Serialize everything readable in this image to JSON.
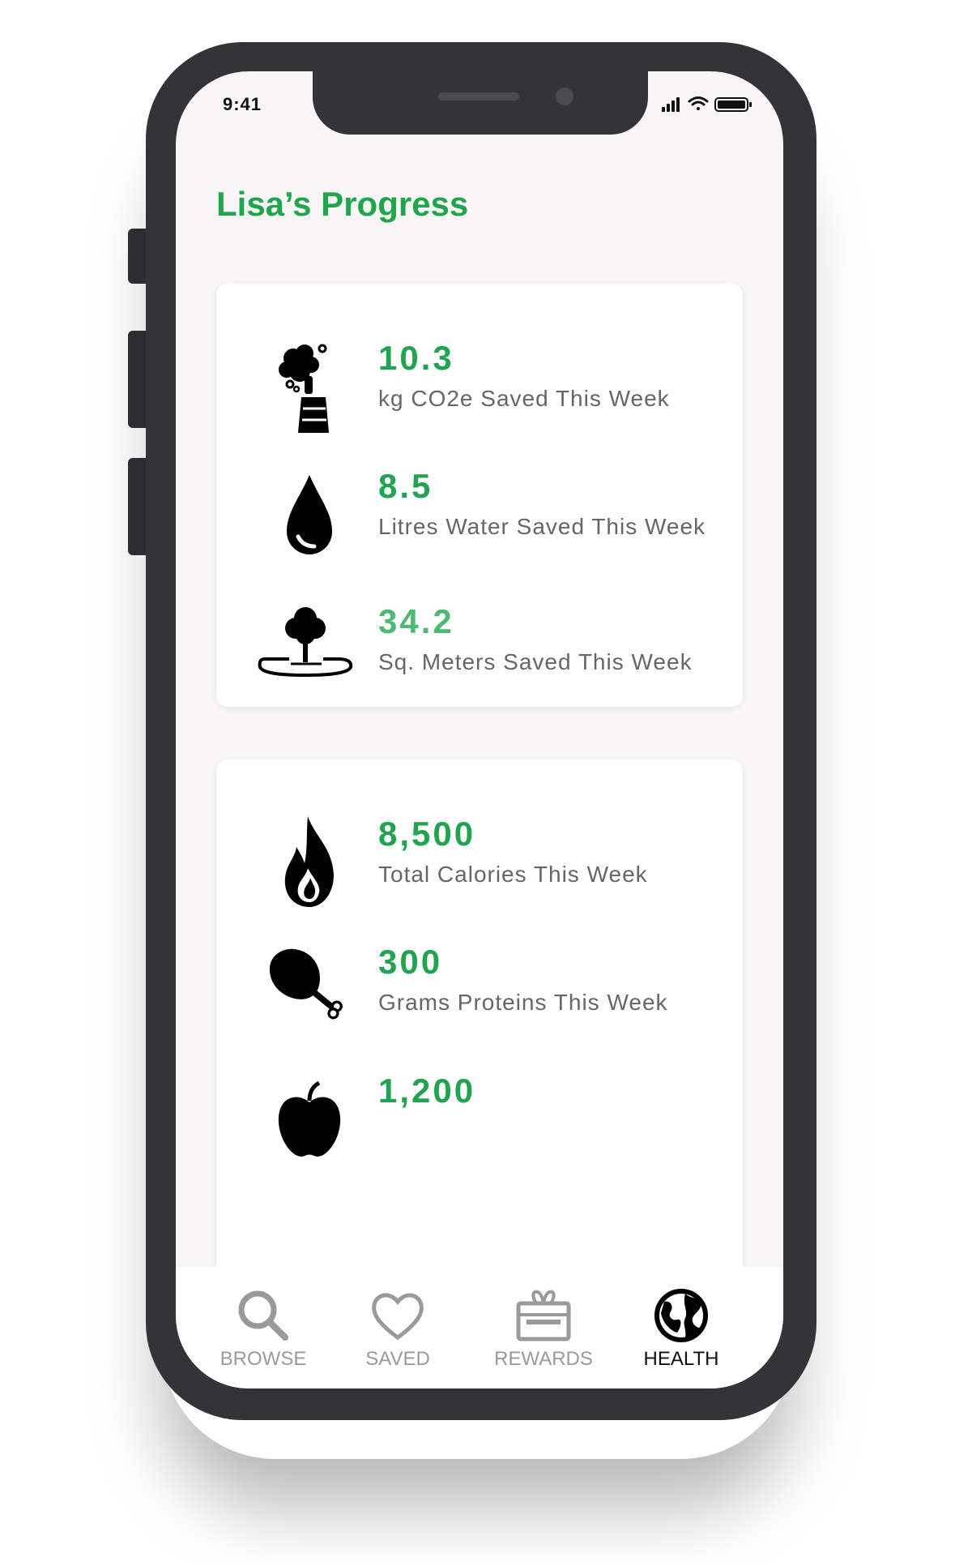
{
  "status_bar": {
    "time": "9:41"
  },
  "page": {
    "title": "Lisa’s Progress"
  },
  "environment_card": {
    "items": [
      {
        "value": "10.3",
        "label": "kg CO2e Saved This Week",
        "icon": "factory-smoke-icon"
      },
      {
        "value": "8.5",
        "label": "Litres Water Saved This Week",
        "icon": "water-drop-icon"
      },
      {
        "value": "34.2",
        "label": "Sq. Meters Saved This Week",
        "icon": "tree-land-icon"
      }
    ]
  },
  "health_card": {
    "items": [
      {
        "value": "8,500",
        "label": "Total Calories This Week",
        "icon": "fire-icon"
      },
      {
        "value": "300",
        "label": "Grams Proteins This Week",
        "icon": "chicken-leg-icon"
      },
      {
        "value": "1,200",
        "label": "",
        "icon": "apple-icon"
      }
    ]
  },
  "tab_bar": {
    "tabs": [
      {
        "label": "BROWSE",
        "icon": "search-icon"
      },
      {
        "label": "SAVED",
        "icon": "heart-icon"
      },
      {
        "label": "REWARDS",
        "icon": "gift-icon"
      },
      {
        "label": "HEALTH",
        "icon": "globe-icon",
        "active": true
      }
    ]
  },
  "colors": {
    "accent": "#22a34f",
    "title": "#1fa64a",
    "frame": "#343438"
  }
}
